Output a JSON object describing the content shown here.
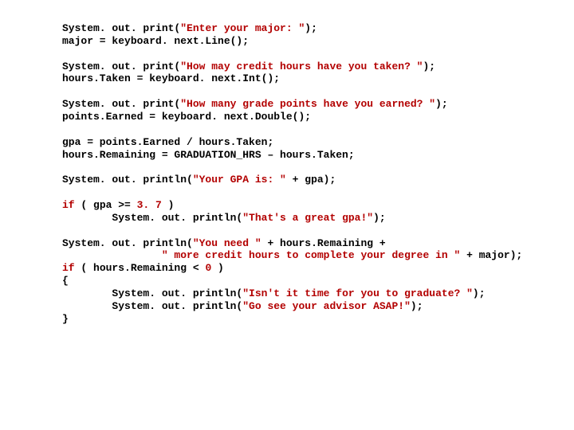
{
  "lines": [
    {
      "indent": 0,
      "segs": [
        {
          "t": "System. out. print("
        },
        {
          "t": "\"Enter your major: \"",
          "c": "str"
        },
        {
          "t": ");"
        }
      ]
    },
    {
      "indent": 0,
      "segs": [
        {
          "t": "major = keyboard. next.Line();"
        }
      ]
    },
    {
      "blank": true
    },
    {
      "indent": 0,
      "segs": [
        {
          "t": "System. out. print("
        },
        {
          "t": "\"How may credit hours have you taken? \"",
          "c": "str"
        },
        {
          "t": ");"
        }
      ]
    },
    {
      "indent": 0,
      "segs": [
        {
          "t": "hours.Taken = keyboard. next.Int();"
        }
      ]
    },
    {
      "blank": true
    },
    {
      "indent": 0,
      "segs": [
        {
          "t": "System. out. print("
        },
        {
          "t": "\"How many grade points have you earned? \"",
          "c": "str"
        },
        {
          "t": ");"
        }
      ]
    },
    {
      "indent": 0,
      "segs": [
        {
          "t": "points.Earned = keyboard. next.Double();"
        }
      ]
    },
    {
      "blank": true
    },
    {
      "indent": 0,
      "segs": [
        {
          "t": "gpa = points.Earned / hours.Taken;"
        }
      ]
    },
    {
      "indent": 0,
      "segs": [
        {
          "t": "hours.Remaining = GRADUATION_HRS – hours.Taken;"
        }
      ]
    },
    {
      "blank": true
    },
    {
      "indent": 0,
      "segs": [
        {
          "t": "System. out. println("
        },
        {
          "t": "\"Your GPA is: \"",
          "c": "str"
        },
        {
          "t": " + gpa);"
        }
      ]
    },
    {
      "blank": true
    },
    {
      "indent": 0,
      "segs": [
        {
          "t": "if",
          "c": "kw"
        },
        {
          "t": " ( gpa >= "
        },
        {
          "t": "3. 7",
          "c": "num"
        },
        {
          "t": " )"
        }
      ]
    },
    {
      "indent": 1,
      "segs": [
        {
          "t": "System. out. println("
        },
        {
          "t": "\"That's a great gpa!\"",
          "c": "str"
        },
        {
          "t": ");"
        }
      ]
    },
    {
      "blank": true
    },
    {
      "indent": 0,
      "segs": [
        {
          "t": "System. out. println("
        },
        {
          "t": "\"You need \"",
          "c": "str"
        },
        {
          "t": " + hours.Remaining +"
        }
      ]
    },
    {
      "indent": 2,
      "segs": [
        {
          "t": "\" more credit hours to complete your degree in \"",
          "c": "str"
        },
        {
          "t": " + major);"
        }
      ]
    },
    {
      "indent": 0,
      "segs": [
        {
          "t": "if",
          "c": "kw"
        },
        {
          "t": " ( hours.Remaining < "
        },
        {
          "t": "0",
          "c": "num"
        },
        {
          "t": " )"
        }
      ]
    },
    {
      "indent": 0,
      "segs": [
        {
          "t": "{"
        }
      ]
    },
    {
      "indent": 1,
      "segs": [
        {
          "t": "System. out. println("
        },
        {
          "t": "\"Isn't it time for you to graduate? \"",
          "c": "str"
        },
        {
          "t": ");"
        }
      ]
    },
    {
      "indent": 1,
      "segs": [
        {
          "t": "System. out. println("
        },
        {
          "t": "\"Go see your advisor ASAP!\"",
          "c": "str"
        },
        {
          "t": ");"
        }
      ]
    },
    {
      "indent": 0,
      "segs": [
        {
          "t": "}"
        }
      ]
    }
  ],
  "indentUnit": "        "
}
